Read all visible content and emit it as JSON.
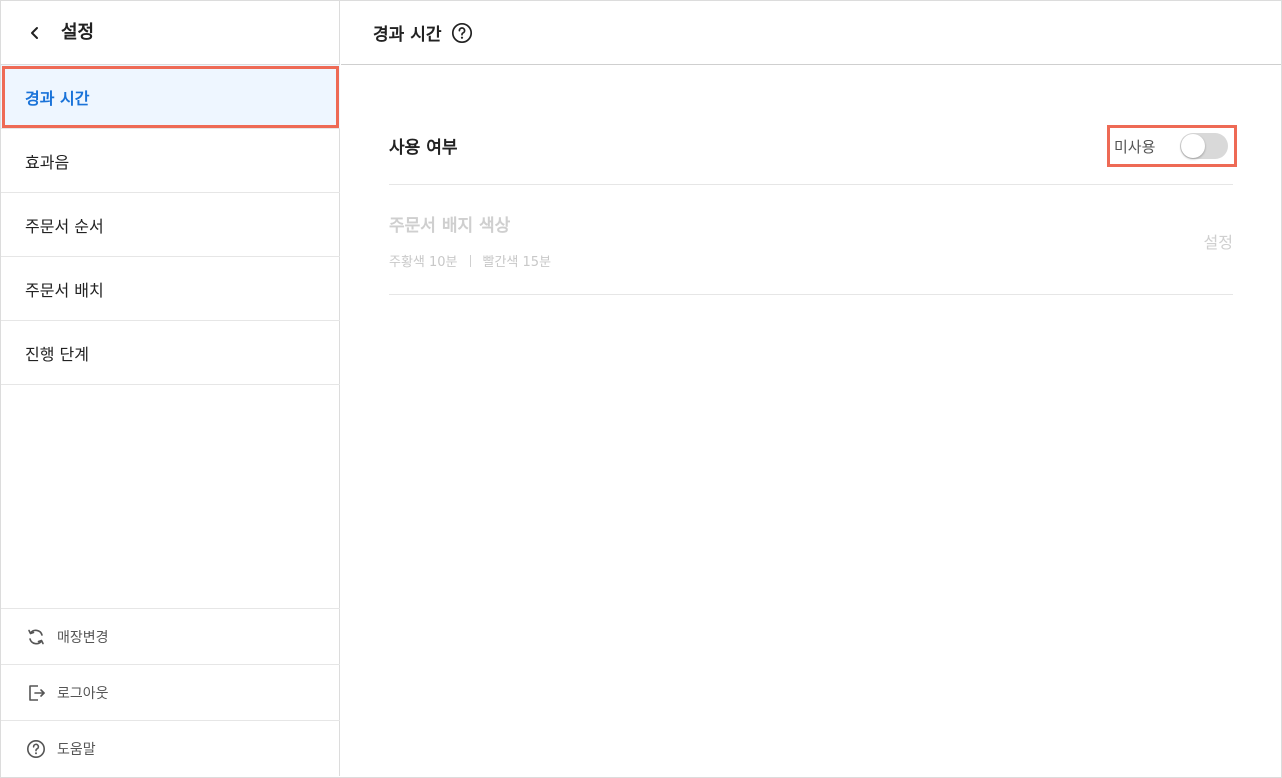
{
  "sidebar": {
    "title": "설정",
    "menu": [
      {
        "label": "경과 시간",
        "active": true
      },
      {
        "label": "효과음",
        "active": false
      },
      {
        "label": "주문서 순서",
        "active": false
      },
      {
        "label": "주문서 배치",
        "active": false
      },
      {
        "label": "진행 단계",
        "active": false
      }
    ],
    "footer": [
      {
        "label": "매장변경",
        "icon": "refresh-icon"
      },
      {
        "label": "로그아웃",
        "icon": "logout-icon"
      },
      {
        "label": "도움말",
        "icon": "help-icon"
      }
    ]
  },
  "main": {
    "title": "경과 시간",
    "use_row": {
      "label": "사용 여부",
      "toggle_text": "미사용",
      "toggle_on": false
    },
    "badge_row": {
      "title": "주문서 배지 색상",
      "sub_orange": "주황색 10분",
      "sub_red": "빨간색 15분",
      "action": "설정"
    }
  },
  "colors": {
    "accent": "#1a73d9",
    "active_bg": "#eef6ff",
    "highlight": "#ee6a55"
  }
}
